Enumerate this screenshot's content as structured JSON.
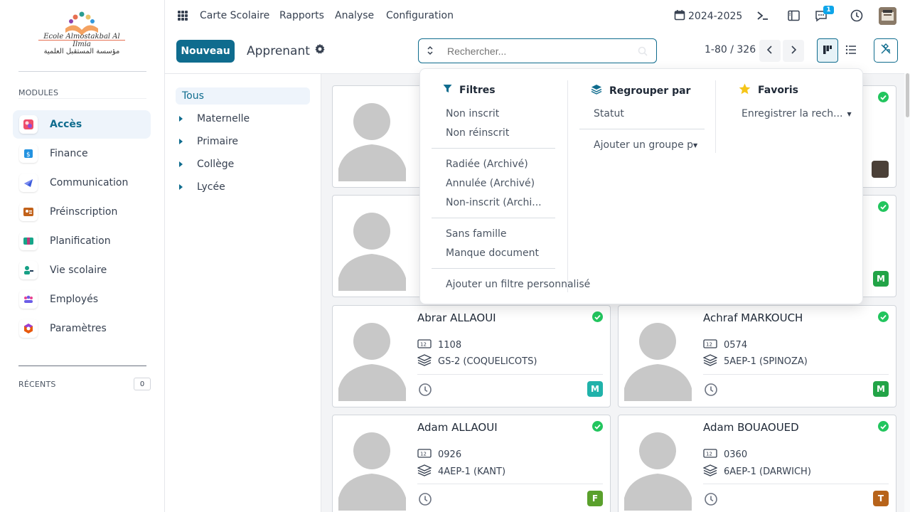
{
  "sidebar": {
    "logo_text_top": "Ecole Almostakbal Al Ilmia",
    "logo_text_bottom": "مؤسسة المستقبل العلمية",
    "modules_label": "MODULES",
    "modules": [
      {
        "label": "Accès",
        "icon": "access-icon",
        "active": true
      },
      {
        "label": "Finance",
        "icon": "finance-icon"
      },
      {
        "label": "Communication",
        "icon": "communication-icon"
      },
      {
        "label": "Préinscription",
        "icon": "preinscription-icon"
      },
      {
        "label": "Planification",
        "icon": "planification-icon"
      },
      {
        "label": "Vie scolaire",
        "icon": "vie-scolaire-icon"
      },
      {
        "label": "Employés",
        "icon": "employees-icon"
      },
      {
        "label": "Paramètres",
        "icon": "settings-icon"
      }
    ],
    "recents_label": "RÉCENTS",
    "recents_count": "0"
  },
  "topbar": {
    "menus": [
      "Carte Scolaire",
      "Rapports",
      "Analyse",
      "Configuration"
    ],
    "year": "2024-2025",
    "messages_badge": "1"
  },
  "control": {
    "new_button": "Nouveau",
    "breadcrumb": "Apprenant",
    "search_placeholder": "Rechercher...",
    "pager": "1-80 / 326"
  },
  "categories": {
    "all": "Tous",
    "items": [
      "Maternelle",
      "Primaire",
      "Collège",
      "Lycée"
    ]
  },
  "cards": [
    {
      "name": "Abrar ALLAOUI",
      "code": "1108",
      "class": "GS-2 (COQUELICOTS)",
      "tag": "M",
      "tag_color": "#20b2aa"
    },
    {
      "name": "Achraf MARKOUCH",
      "code": "0574",
      "class": "5AEP-1 (SPINOZA)",
      "tag": "M",
      "tag_color": "#22a447"
    },
    {
      "name": "Adam ALLAOUI",
      "code": "0926",
      "class": "4AEP-1 (KANT)",
      "tag": "F",
      "tag_color": "#5aa02c"
    },
    {
      "name": "Adam BOUAOUED",
      "code": "0360",
      "class": "6AEP-1 (DARWICH)",
      "tag": "T",
      "tag_color": "#b7631a"
    }
  ],
  "hidden_cards_tags": {
    "card2_right_tag": "M",
    "card2_right_color": "#22a447"
  },
  "filters": {
    "title": "Filtres",
    "group1": [
      "Non inscrit",
      "Non réinscrit"
    ],
    "group2": [
      "Radiée (Archivé)",
      "Annulée (Archivé)",
      "Non-inscrit (Archi..."
    ],
    "group3": [
      "Sans famille",
      "Manque document"
    ],
    "add_custom": "Ajouter un filtre personnalisé"
  },
  "groupby": {
    "title": "Regrouper par",
    "items": [
      "Statut"
    ],
    "add_custom": "Ajouter un groupe pe"
  },
  "favorites": {
    "title": "Favoris",
    "save": "Enregistrer la rech..."
  },
  "colors": {
    "primary": "#0f6c8e",
    "success": "#22c55e",
    "star": "#f5c518"
  }
}
